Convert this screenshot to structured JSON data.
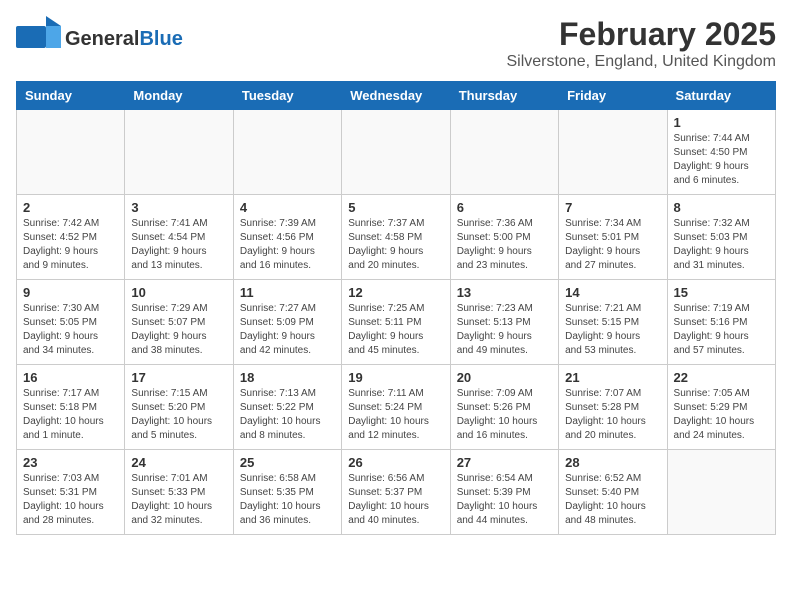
{
  "header": {
    "logo_general": "General",
    "logo_blue": "Blue",
    "month_title": "February 2025",
    "location": "Silverstone, England, United Kingdom"
  },
  "days_of_week": [
    "Sunday",
    "Monday",
    "Tuesday",
    "Wednesday",
    "Thursday",
    "Friday",
    "Saturday"
  ],
  "weeks": [
    {
      "days": [
        {
          "number": "",
          "info": ""
        },
        {
          "number": "",
          "info": ""
        },
        {
          "number": "",
          "info": ""
        },
        {
          "number": "",
          "info": ""
        },
        {
          "number": "",
          "info": ""
        },
        {
          "number": "",
          "info": ""
        },
        {
          "number": "1",
          "info": "Sunrise: 7:44 AM\nSunset: 4:50 PM\nDaylight: 9 hours\nand 6 minutes."
        }
      ]
    },
    {
      "days": [
        {
          "number": "2",
          "info": "Sunrise: 7:42 AM\nSunset: 4:52 PM\nDaylight: 9 hours\nand 9 minutes."
        },
        {
          "number": "3",
          "info": "Sunrise: 7:41 AM\nSunset: 4:54 PM\nDaylight: 9 hours\nand 13 minutes."
        },
        {
          "number": "4",
          "info": "Sunrise: 7:39 AM\nSunset: 4:56 PM\nDaylight: 9 hours\nand 16 minutes."
        },
        {
          "number": "5",
          "info": "Sunrise: 7:37 AM\nSunset: 4:58 PM\nDaylight: 9 hours\nand 20 minutes."
        },
        {
          "number": "6",
          "info": "Sunrise: 7:36 AM\nSunset: 5:00 PM\nDaylight: 9 hours\nand 23 minutes."
        },
        {
          "number": "7",
          "info": "Sunrise: 7:34 AM\nSunset: 5:01 PM\nDaylight: 9 hours\nand 27 minutes."
        },
        {
          "number": "8",
          "info": "Sunrise: 7:32 AM\nSunset: 5:03 PM\nDaylight: 9 hours\nand 31 minutes."
        }
      ]
    },
    {
      "days": [
        {
          "number": "9",
          "info": "Sunrise: 7:30 AM\nSunset: 5:05 PM\nDaylight: 9 hours\nand 34 minutes."
        },
        {
          "number": "10",
          "info": "Sunrise: 7:29 AM\nSunset: 5:07 PM\nDaylight: 9 hours\nand 38 minutes."
        },
        {
          "number": "11",
          "info": "Sunrise: 7:27 AM\nSunset: 5:09 PM\nDaylight: 9 hours\nand 42 minutes."
        },
        {
          "number": "12",
          "info": "Sunrise: 7:25 AM\nSunset: 5:11 PM\nDaylight: 9 hours\nand 45 minutes."
        },
        {
          "number": "13",
          "info": "Sunrise: 7:23 AM\nSunset: 5:13 PM\nDaylight: 9 hours\nand 49 minutes."
        },
        {
          "number": "14",
          "info": "Sunrise: 7:21 AM\nSunset: 5:15 PM\nDaylight: 9 hours\nand 53 minutes."
        },
        {
          "number": "15",
          "info": "Sunrise: 7:19 AM\nSunset: 5:16 PM\nDaylight: 9 hours\nand 57 minutes."
        }
      ]
    },
    {
      "days": [
        {
          "number": "16",
          "info": "Sunrise: 7:17 AM\nSunset: 5:18 PM\nDaylight: 10 hours\nand 1 minute."
        },
        {
          "number": "17",
          "info": "Sunrise: 7:15 AM\nSunset: 5:20 PM\nDaylight: 10 hours\nand 5 minutes."
        },
        {
          "number": "18",
          "info": "Sunrise: 7:13 AM\nSunset: 5:22 PM\nDaylight: 10 hours\nand 8 minutes."
        },
        {
          "number": "19",
          "info": "Sunrise: 7:11 AM\nSunset: 5:24 PM\nDaylight: 10 hours\nand 12 minutes."
        },
        {
          "number": "20",
          "info": "Sunrise: 7:09 AM\nSunset: 5:26 PM\nDaylight: 10 hours\nand 16 minutes."
        },
        {
          "number": "21",
          "info": "Sunrise: 7:07 AM\nSunset: 5:28 PM\nDaylight: 10 hours\nand 20 minutes."
        },
        {
          "number": "22",
          "info": "Sunrise: 7:05 AM\nSunset: 5:29 PM\nDaylight: 10 hours\nand 24 minutes."
        }
      ]
    },
    {
      "days": [
        {
          "number": "23",
          "info": "Sunrise: 7:03 AM\nSunset: 5:31 PM\nDaylight: 10 hours\nand 28 minutes."
        },
        {
          "number": "24",
          "info": "Sunrise: 7:01 AM\nSunset: 5:33 PM\nDaylight: 10 hours\nand 32 minutes."
        },
        {
          "number": "25",
          "info": "Sunrise: 6:58 AM\nSunset: 5:35 PM\nDaylight: 10 hours\nand 36 minutes."
        },
        {
          "number": "26",
          "info": "Sunrise: 6:56 AM\nSunset: 5:37 PM\nDaylight: 10 hours\nand 40 minutes."
        },
        {
          "number": "27",
          "info": "Sunrise: 6:54 AM\nSunset: 5:39 PM\nDaylight: 10 hours\nand 44 minutes."
        },
        {
          "number": "28",
          "info": "Sunrise: 6:52 AM\nSunset: 5:40 PM\nDaylight: 10 hours\nand 48 minutes."
        },
        {
          "number": "",
          "info": ""
        }
      ]
    }
  ]
}
